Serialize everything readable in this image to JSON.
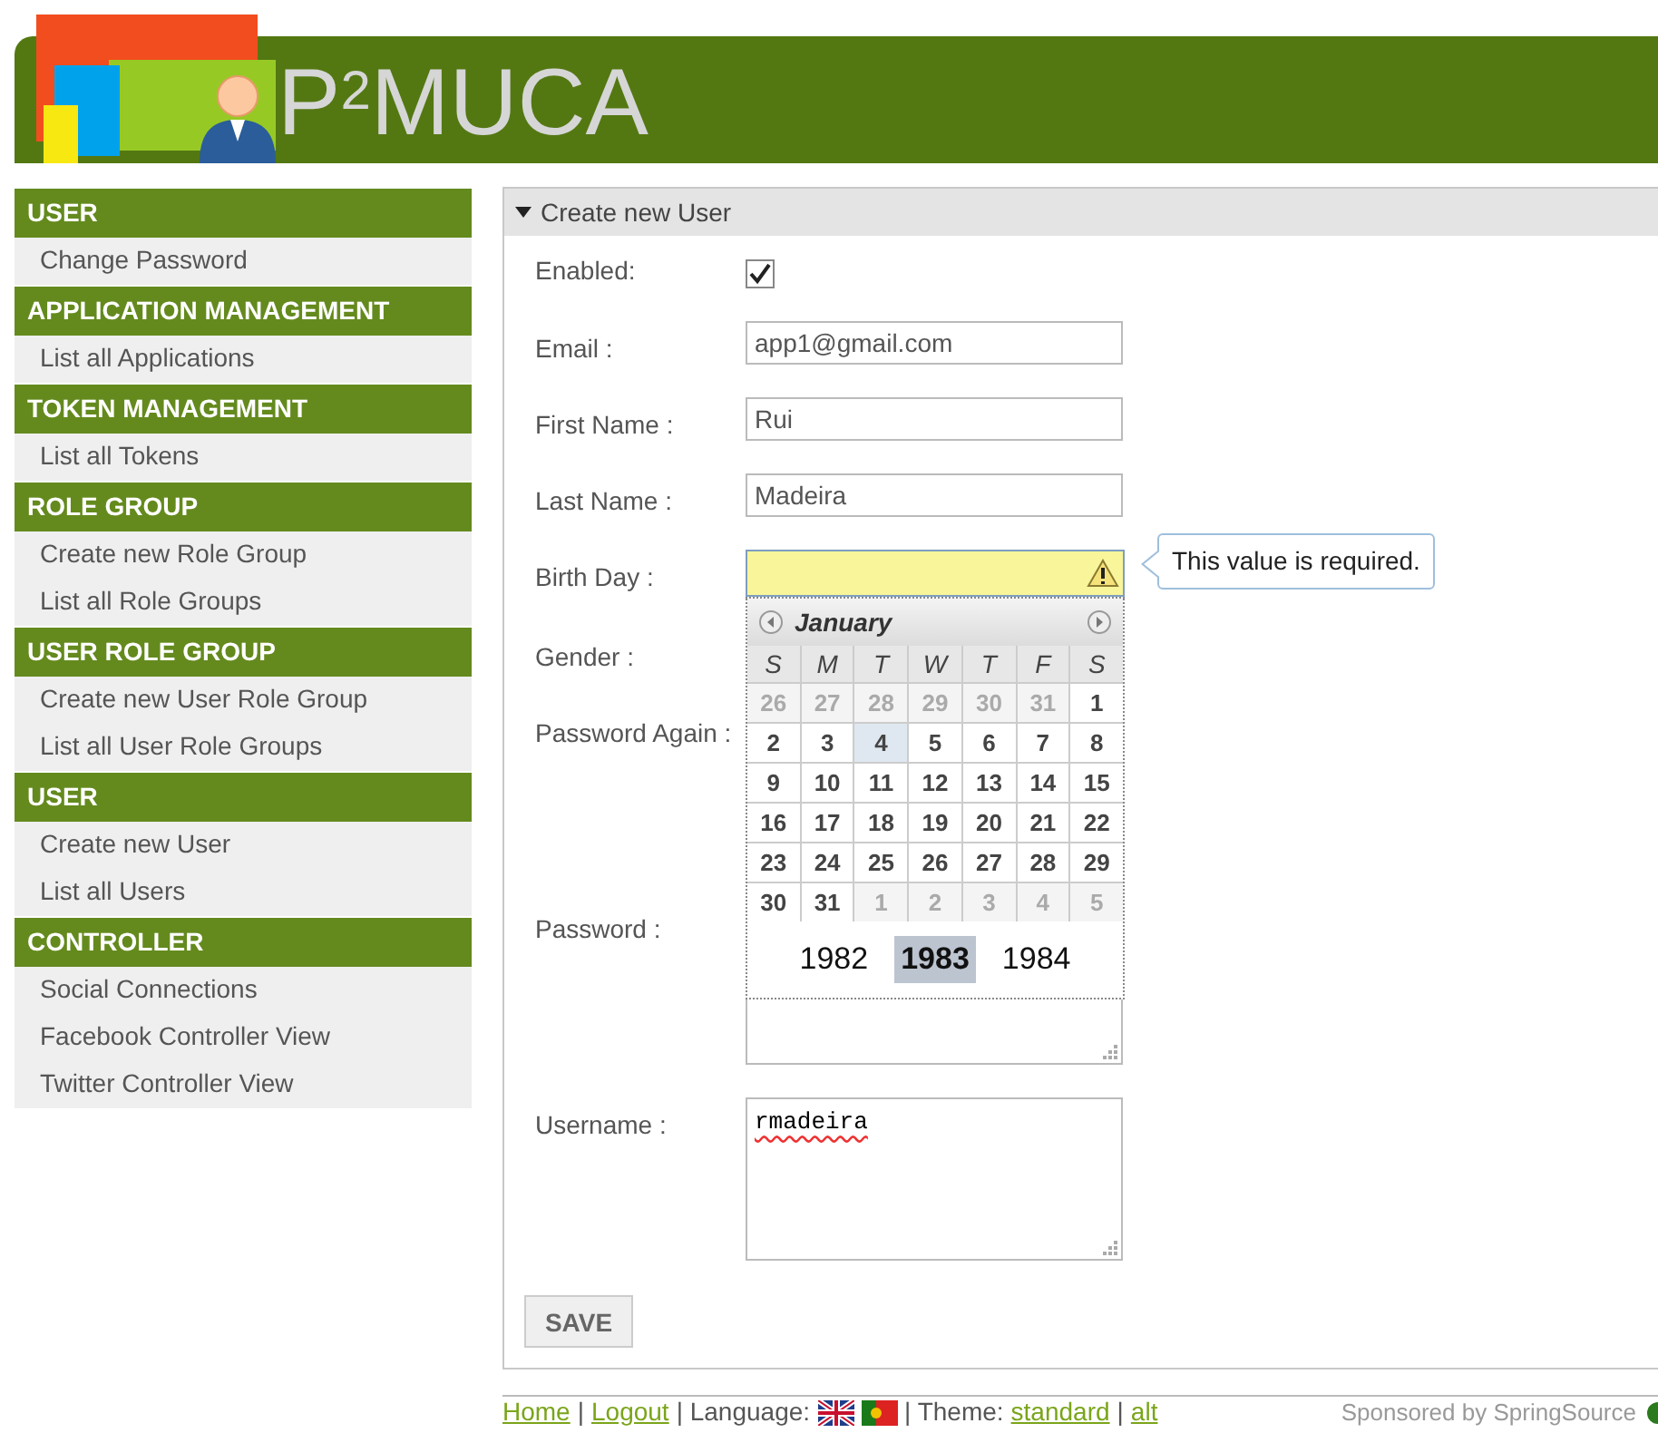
{
  "header": {
    "logo_text": "P$^{2}$MUCA"
  },
  "sidebar": {
    "sections": [
      {
        "title": "USER",
        "items": [
          "Change Password"
        ]
      },
      {
        "title": "APPLICATION MANAGEMENT",
        "items": [
          "List all Applications"
        ]
      },
      {
        "title": "TOKEN MANAGEMENT",
        "items": [
          "List all Tokens"
        ]
      },
      {
        "title": "ROLE GROUP",
        "items": [
          "Create new Role Group",
          "List all Role Groups"
        ]
      },
      {
        "title": "USER ROLE GROUP",
        "items": [
          "Create new User Role Group",
          "List all User Role Groups"
        ]
      },
      {
        "title": "USER",
        "items": [
          "Create new User",
          "List all Users"
        ]
      },
      {
        "title": "CONTROLLER",
        "items": [
          "Social Connections",
          "Facebook Controller View",
          "Twitter Controller View"
        ]
      }
    ]
  },
  "panel": {
    "title": "Create new User",
    "expanded": true
  },
  "form": {
    "fields": [
      {
        "kind": "checkbox",
        "label": "Enabled:",
        "checked": true
      },
      {
        "kind": "text",
        "label": "Email :",
        "value": "app1@gmail.com"
      },
      {
        "kind": "text",
        "label": "First Name :",
        "value": "Rui"
      },
      {
        "kind": "text",
        "label": "Last Name :",
        "value": "Madeira"
      },
      {
        "kind": "date",
        "label": "Birth Day :",
        "invalid": true,
        "message": "This value is required."
      },
      {
        "kind": "hidden",
        "label": "Gender :"
      },
      {
        "kind": "hidden-area",
        "label": "Password Again :"
      },
      {
        "kind": "textarea",
        "label": "Password :"
      },
      {
        "kind": "textarea",
        "label": "Username :",
        "value": "rmadeira",
        "misspelled": true
      }
    ],
    "save": "SAVE"
  },
  "calendar": {
    "month": "January",
    "weekdays": [
      "S",
      "M",
      "T",
      "W",
      "T",
      "F",
      "S"
    ],
    "weeks": [
      [
        {
          "label": "26",
          "outside": true,
          "selected": false
        },
        {
          "label": "27",
          "outside": true,
          "selected": false
        },
        {
          "label": "28",
          "outside": true,
          "selected": false
        },
        {
          "label": "29",
          "outside": true,
          "selected": false
        },
        {
          "label": "30",
          "outside": true,
          "selected": false
        },
        {
          "label": "31",
          "outside": true,
          "selected": false
        },
        {
          "label": "1",
          "outside": false,
          "selected": false
        }
      ],
      [
        {
          "label": "2",
          "outside": false,
          "selected": false
        },
        {
          "label": "3",
          "outside": false,
          "selected": false
        },
        {
          "label": "4",
          "outside": false,
          "selected": true
        },
        {
          "label": "5",
          "outside": false,
          "selected": false
        },
        {
          "label": "6",
          "outside": false,
          "selected": false
        },
        {
          "label": "7",
          "outside": false,
          "selected": false
        },
        {
          "label": "8",
          "outside": false,
          "selected": false
        }
      ],
      [
        {
          "label": "9",
          "outside": false,
          "selected": false
        },
        {
          "label": "10",
          "outside": false,
          "selected": false
        },
        {
          "label": "11",
          "outside": false,
          "selected": false
        },
        {
          "label": "12",
          "outside": false,
          "selected": false
        },
        {
          "label": "13",
          "outside": false,
          "selected": false
        },
        {
          "label": "14",
          "outside": false,
          "selected": false
        },
        {
          "label": "15",
          "outside": false,
          "selected": false
        }
      ],
      [
        {
          "label": "16",
          "outside": false,
          "selected": false
        },
        {
          "label": "17",
          "outside": false,
          "selected": false
        },
        {
          "label": "18",
          "outside": false,
          "selected": false
        },
        {
          "label": "19",
          "outside": false,
          "selected": false
        },
        {
          "label": "20",
          "outside": false,
          "selected": false
        },
        {
          "label": "21",
          "outside": false,
          "selected": false
        },
        {
          "label": "22",
          "outside": false,
          "selected": false
        }
      ],
      [
        {
          "label": "23",
          "outside": false,
          "selected": false
        },
        {
          "label": "24",
          "outside": false,
          "selected": false
        },
        {
          "label": "25",
          "outside": false,
          "selected": false
        },
        {
          "label": "26",
          "outside": false,
          "selected": false
        },
        {
          "label": "27",
          "outside": false,
          "selected": false
        },
        {
          "label": "28",
          "outside": false,
          "selected": false
        },
        {
          "label": "29",
          "outside": false,
          "selected": false
        }
      ],
      [
        {
          "label": "30",
          "outside": false,
          "selected": false
        },
        {
          "label": "31",
          "outside": false,
          "selected": false
        },
        {
          "label": "1",
          "outside": true,
          "selected": false
        },
        {
          "label": "2",
          "outside": true,
          "selected": false
        },
        {
          "label": "3",
          "outside": true,
          "selected": false
        },
        {
          "label": "4",
          "outside": true,
          "selected": false
        },
        {
          "label": "5",
          "outside": true,
          "selected": false
        }
      ]
    ],
    "years": [
      {
        "label": "1982",
        "selected": false
      },
      {
        "label": "1983",
        "selected": true
      },
      {
        "label": "1984",
        "selected": false
      }
    ]
  },
  "footer": {
    "items": [
      {
        "kind": "link",
        "text": "Home"
      },
      {
        "kind": "text",
        "text": "|"
      },
      {
        "kind": "link",
        "text": "Logout"
      },
      {
        "kind": "text",
        "text": "| Language:"
      },
      {
        "kind": "flag_gb"
      },
      {
        "kind": "flag_pt"
      },
      {
        "kind": "text",
        "text": "| Theme:"
      },
      {
        "kind": "link",
        "text": "standard"
      },
      {
        "kind": "text",
        "text": "|"
      },
      {
        "kind": "link",
        "text": "alt"
      }
    ],
    "sponsor": "Sponsored by SpringSource"
  }
}
